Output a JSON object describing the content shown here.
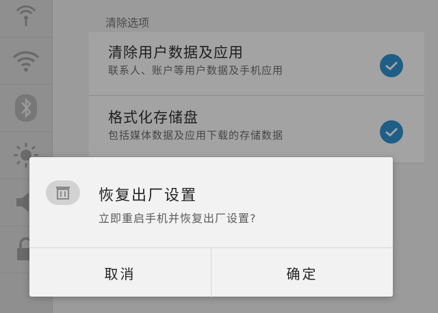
{
  "section": {
    "header": "清除选项"
  },
  "options": [
    {
      "title": "清除用户数据及应用",
      "description": "联系人、账户等用户数据及手机应用",
      "checked": true
    },
    {
      "title": "格式化存储盘",
      "description": "包括媒体数据及应用下载的存储数据",
      "checked": true
    }
  ],
  "sidebar": {
    "icons": [
      "signal-tower-icon",
      "wifi-icon",
      "bluetooth-icon",
      "brightness-icon",
      "volume-icon",
      "lock-icon"
    ]
  },
  "dialog": {
    "icon": "trash-icon",
    "title": "恢复出厂设置",
    "message": "立即重启手机并恢复出厂设置?",
    "cancel_label": "取消",
    "confirm_label": "确定"
  },
  "colors": {
    "check": "#1f5e86",
    "dialog_bg": "#f2f2f2",
    "overlay": "#9b9b9b"
  }
}
